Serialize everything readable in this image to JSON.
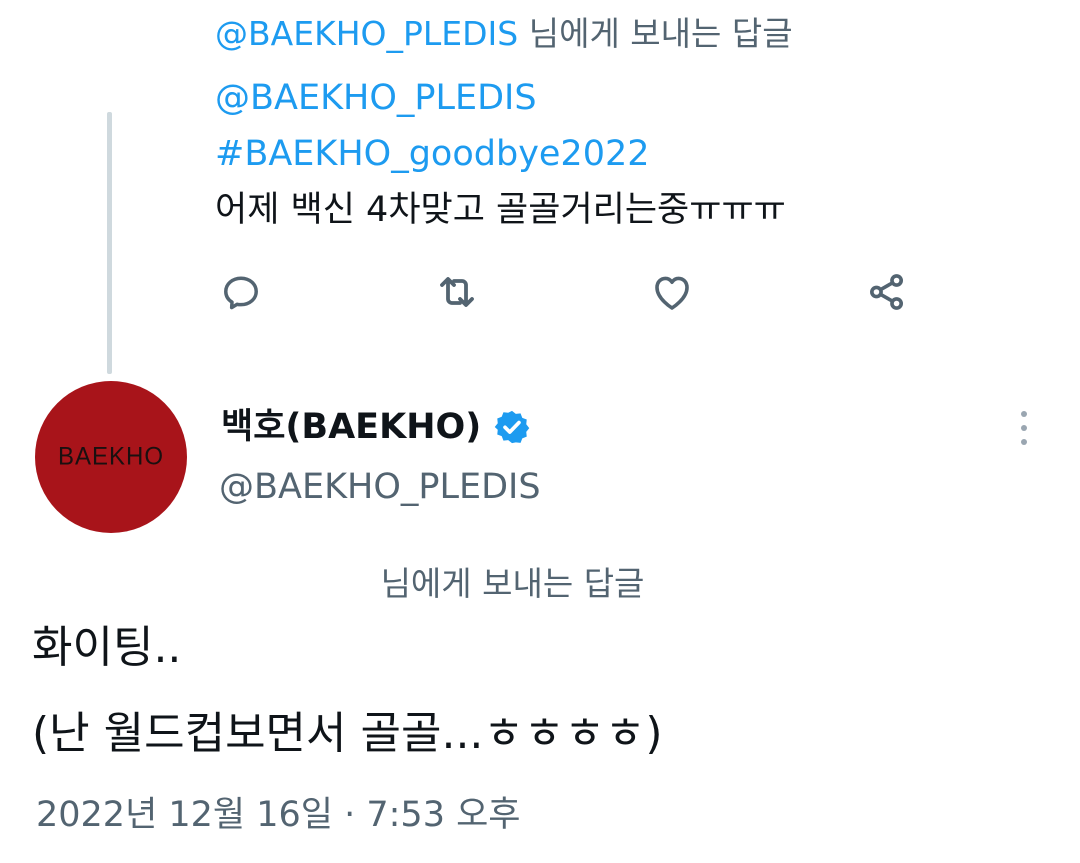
{
  "parent_tweet": {
    "reply_to_handle": "@BAEKHO_PLEDIS",
    "reply_to_suffix": " 님에게 보내는 답글",
    "lines": {
      "mention": "@BAEKHO_PLEDIS",
      "hashtag": "#BAEKHO_goodbye2022",
      "text": "어제 백신 4차맞고 골골거리는중ㅠㅠㅠ"
    },
    "actions": {
      "reply_icon": "reply-icon",
      "retweet_icon": "retweet-icon",
      "like_icon": "heart-icon",
      "share_icon": "share-icon"
    }
  },
  "main_tweet": {
    "avatar_logo": "BAEKHO",
    "display_name": "백호(BAEKHO)",
    "handle": "@BAEKHO_PLEDIS",
    "reply_note": "님에게 보내는 답글",
    "body_line_1": "화이팅..",
    "body_line_2": "(난 월드컵보면서 골골...ㅎㅎㅎㅎ)",
    "timestamp": "2022년 12월 16일 · 7:53 오후"
  },
  "colors": {
    "link": "#1d9bf0",
    "secondary_text": "#536471",
    "avatar_bg": "#a8141a",
    "thread_line": "#cfd9de",
    "verified": "#1d9bf0"
  }
}
